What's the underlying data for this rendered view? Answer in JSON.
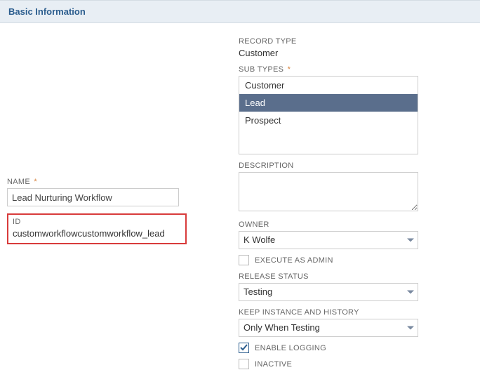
{
  "section_title": "Basic Information",
  "left": {
    "name_label": "NAME",
    "name_value": "Lead Nurturing Workflow",
    "id_label": "ID",
    "id_value": "customworkflowcustomworkflow_lead"
  },
  "right": {
    "record_type_label": "RECORD TYPE",
    "record_type_value": "Customer",
    "sub_types_label": "SUB TYPES",
    "sub_types": {
      "options": [
        "Customer",
        "Lead",
        "Prospect"
      ],
      "selected": "Lead"
    },
    "description_label": "DESCRIPTION",
    "description_value": "",
    "owner_label": "OWNER",
    "owner_value": "K Wolfe",
    "execute_as_admin_label": "EXECUTE AS ADMIN",
    "execute_as_admin_checked": false,
    "release_status_label": "RELEASE STATUS",
    "release_status_value": "Testing",
    "keep_instance_label": "KEEP INSTANCE AND HISTORY",
    "keep_instance_value": "Only When Testing",
    "enable_logging_label": "ENABLE LOGGING",
    "enable_logging_checked": true,
    "inactive_label": "INACTIVE",
    "inactive_checked": false
  }
}
